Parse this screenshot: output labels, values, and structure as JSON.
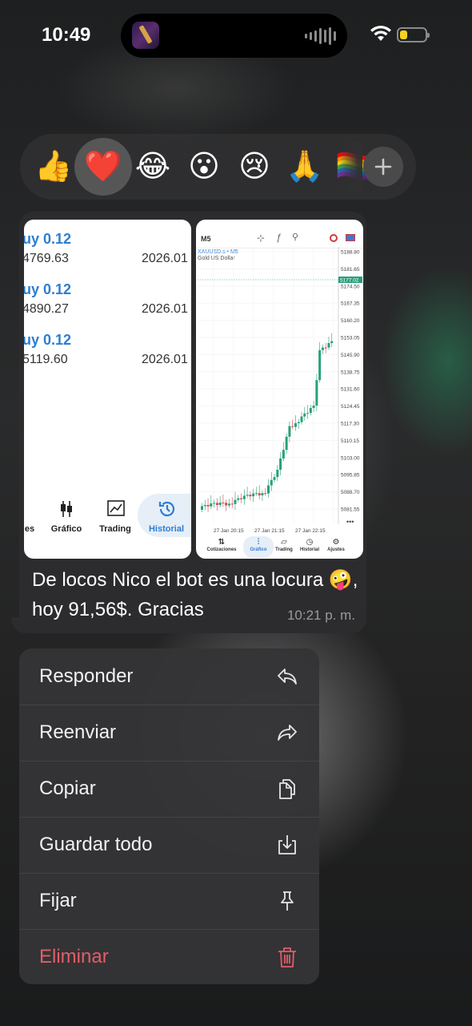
{
  "status_bar": {
    "time": "10:49"
  },
  "reactions": {
    "items": [
      "👍",
      "❤️",
      "😂",
      "😮",
      "😢",
      "🙏",
      "🏳️‍🌈"
    ],
    "selected": "❤️",
    "more_icon": "plus-icon"
  },
  "message": {
    "text": "De locos Nico el bot es una locura 🤪, hoy 91,56$. Gracias",
    "time": "10:21 p. m.",
    "left_screenshot": {
      "trades": [
        {
          "type": "uy 0.12",
          "price": "4769.63",
          "date": "2026.01"
        },
        {
          "type": "uy 0.12",
          "price": "4890.27",
          "date": "2026.01"
        },
        {
          "type": "uy 0.12",
          "price": "5119.60",
          "date": "2026.01"
        }
      ],
      "tabs": [
        "es",
        "Gráfico",
        "Trading",
        "Historial"
      ],
      "active_tab": "Historial"
    },
    "right_screenshot": {
      "timeframe": "M5",
      "symbol": "XAUUSD.s • M5",
      "symbol_desc": "Gold US Dollar",
      "current_price": "5177.02",
      "chart_data": {
        "type": "candlestick",
        "y_ticks": [
          "5188.80",
          "5181.65",
          "5174.50",
          "5167.35",
          "5160.20",
          "5153.05",
          "5145.90",
          "5138.75",
          "5131.60",
          "5124.45",
          "5117.30",
          "5110.15",
          "5103.00",
          "5095.85",
          "5088.70",
          "5081.55"
        ],
        "x_ticks": [
          "27 Jan 20:15",
          "27 Jan 21:15",
          "27 Jan 22:15"
        ]
      },
      "tabs": [
        "Cotizaciones",
        "Gráfico",
        "Trading",
        "Historial",
        "Ajustes"
      ],
      "active_tab": "Gráfico"
    }
  },
  "menu": {
    "items": [
      {
        "label": "Responder",
        "icon": "reply-icon"
      },
      {
        "label": "Reenviar",
        "icon": "forward-icon"
      },
      {
        "label": "Copiar",
        "icon": "copy-icon"
      },
      {
        "label": "Guardar todo",
        "icon": "save-icon"
      },
      {
        "label": "Fijar",
        "icon": "pin-icon"
      },
      {
        "label": "Eliminar",
        "icon": "trash-icon",
        "danger": true,
        "color": "#e35d67"
      }
    ]
  }
}
